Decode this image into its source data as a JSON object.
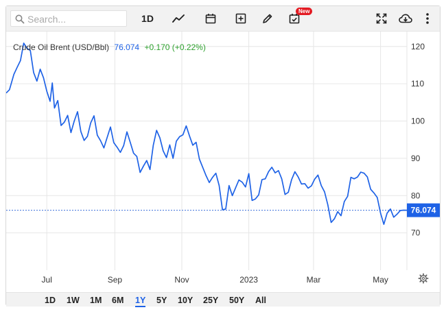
{
  "search": {
    "placeholder": "Search..."
  },
  "toolbar": {
    "range_label": "1D",
    "new_badge": "New",
    "icons": [
      "search-icon",
      "line-chart-icon",
      "calendar-icon",
      "add-indicator-icon",
      "pencil-icon",
      "event-calendar-icon",
      "fullscreen-icon",
      "download-cloud-icon",
      "more-icon"
    ]
  },
  "header": {
    "instrument": "Crude Oil Brent (USD/Bbl)",
    "last": "76.074",
    "change": "+0.170 (+0.22%)"
  },
  "colors": {
    "line": "#1e62e6",
    "change_positive": "#2ca02c",
    "price_label_bg": "#1e62e6"
  },
  "price_label": "76.074",
  "range_buttons": [
    "1D",
    "1W",
    "1M",
    "6M",
    "1Y",
    "5Y",
    "10Y",
    "25Y",
    "50Y",
    "All"
  ],
  "active_range": "1Y",
  "chart_data": {
    "type": "line",
    "title": "Crude Oil Brent (USD/Bbl)",
    "xlabel": "",
    "ylabel": "",
    "x_ticks": [
      "Jul",
      "Sep",
      "Nov",
      "2023",
      "Mar",
      "May"
    ],
    "y_ticks": [
      70,
      80,
      90,
      100,
      110,
      120
    ],
    "ylim": [
      60,
      124
    ],
    "xlim": [
      "2022-05-25",
      "2023-05-25"
    ],
    "grid": true,
    "last_value": 76.074,
    "series": [
      {
        "values": [
          [
            "2022-05-25",
            107.5
          ],
          [
            "2022-05-28",
            108.4
          ],
          [
            "2022-06-01",
            112.5
          ],
          [
            "2022-06-04",
            114.4
          ],
          [
            "2022-06-07",
            116.2
          ],
          [
            "2022-06-10",
            120.9
          ],
          [
            "2022-06-13",
            119.5
          ],
          [
            "2022-06-16",
            118.9
          ],
          [
            "2022-06-19",
            113.0
          ],
          [
            "2022-06-22",
            110.7
          ],
          [
            "2022-06-25",
            113.9
          ],
          [
            "2022-06-28",
            111.6
          ],
          [
            "2022-07-01",
            108.0
          ],
          [
            "2022-07-04",
            105.3
          ],
          [
            "2022-07-06",
            110.2
          ],
          [
            "2022-07-08",
            103.5
          ],
          [
            "2022-07-11",
            105.5
          ],
          [
            "2022-07-14",
            98.8
          ],
          [
            "2022-07-17",
            99.7
          ],
          [
            "2022-07-20",
            101.5
          ],
          [
            "2022-07-23",
            96.9
          ],
          [
            "2022-07-26",
            100.0
          ],
          [
            "2022-07-29",
            102.5
          ],
          [
            "2022-08-01",
            97.2
          ],
          [
            "2022-08-04",
            94.8
          ],
          [
            "2022-08-07",
            95.9
          ],
          [
            "2022-08-10",
            99.5
          ],
          [
            "2022-08-13",
            101.4
          ],
          [
            "2022-08-16",
            96.2
          ],
          [
            "2022-08-19",
            94.7
          ],
          [
            "2022-08-22",
            92.8
          ],
          [
            "2022-08-25",
            95.6
          ],
          [
            "2022-08-28",
            98.4
          ],
          [
            "2022-08-31",
            94.2
          ],
          [
            "2022-09-03",
            93.0
          ],
          [
            "2022-09-06",
            91.6
          ],
          [
            "2022-09-09",
            93.4
          ],
          [
            "2022-09-12",
            97.1
          ],
          [
            "2022-09-15",
            94.3
          ],
          [
            "2022-09-18",
            91.4
          ],
          [
            "2022-09-21",
            90.5
          ],
          [
            "2022-09-24",
            86.2
          ],
          [
            "2022-09-27",
            87.9
          ],
          [
            "2022-09-30",
            89.4
          ],
          [
            "2022-10-03",
            87.0
          ],
          [
            "2022-10-06",
            93.5
          ],
          [
            "2022-10-09",
            97.5
          ],
          [
            "2022-10-12",
            95.5
          ],
          [
            "2022-10-15",
            92.0
          ],
          [
            "2022-10-18",
            90.2
          ],
          [
            "2022-10-21",
            93.6
          ],
          [
            "2022-10-24",
            90.0
          ],
          [
            "2022-10-27",
            94.6
          ],
          [
            "2022-10-30",
            95.8
          ],
          [
            "2022-11-02",
            96.3
          ],
          [
            "2022-11-05",
            98.7
          ],
          [
            "2022-11-08",
            96.0
          ],
          [
            "2022-11-11",
            93.5
          ],
          [
            "2022-11-14",
            94.3
          ],
          [
            "2022-11-17",
            89.8
          ],
          [
            "2022-11-20",
            87.6
          ],
          [
            "2022-11-23",
            85.4
          ],
          [
            "2022-11-26",
            83.5
          ],
          [
            "2022-11-29",
            84.9
          ],
          [
            "2022-12-02",
            86.0
          ],
          [
            "2022-12-05",
            82.7
          ],
          [
            "2022-12-08",
            76.2
          ],
          [
            "2022-12-11",
            76.4
          ],
          [
            "2022-12-14",
            82.7
          ],
          [
            "2022-12-17",
            80.0
          ],
          [
            "2022-12-20",
            82.1
          ],
          [
            "2022-12-23",
            84.2
          ],
          [
            "2022-12-26",
            83.6
          ],
          [
            "2022-12-29",
            82.3
          ],
          [
            "2023-01-01",
            85.9
          ],
          [
            "2023-01-04",
            78.7
          ],
          [
            "2023-01-07",
            79.1
          ],
          [
            "2023-01-10",
            80.2
          ],
          [
            "2023-01-13",
            84.3
          ],
          [
            "2023-01-16",
            84.5
          ],
          [
            "2023-01-19",
            86.4
          ],
          [
            "2023-01-22",
            87.6
          ],
          [
            "2023-01-25",
            86.1
          ],
          [
            "2023-01-28",
            86.7
          ],
          [
            "2023-01-31",
            84.5
          ],
          [
            "2023-02-03",
            80.3
          ],
          [
            "2023-02-06",
            80.9
          ],
          [
            "2023-02-09",
            84.3
          ],
          [
            "2023-02-12",
            86.4
          ],
          [
            "2023-02-15",
            85.0
          ],
          [
            "2023-02-18",
            83.1
          ],
          [
            "2023-02-21",
            83.2
          ],
          [
            "2023-02-24",
            82.0
          ],
          [
            "2023-02-27",
            82.6
          ],
          [
            "2023-03-02",
            84.4
          ],
          [
            "2023-03-05",
            85.5
          ],
          [
            "2023-03-08",
            82.7
          ],
          [
            "2023-03-11",
            81.0
          ],
          [
            "2023-03-14",
            77.5
          ],
          [
            "2023-03-17",
            72.8
          ],
          [
            "2023-03-20",
            73.8
          ],
          [
            "2023-03-23",
            75.7
          ],
          [
            "2023-03-26",
            74.6
          ],
          [
            "2023-03-29",
            78.4
          ],
          [
            "2023-04-01",
            79.8
          ],
          [
            "2023-04-04",
            84.9
          ],
          [
            "2023-04-07",
            84.5
          ],
          [
            "2023-04-10",
            85.0
          ],
          [
            "2023-04-13",
            86.3
          ],
          [
            "2023-04-16",
            86.0
          ],
          [
            "2023-04-19",
            85.0
          ],
          [
            "2023-04-22",
            81.7
          ],
          [
            "2023-04-25",
            80.7
          ],
          [
            "2023-04-28",
            79.5
          ],
          [
            "2023-05-01",
            75.3
          ],
          [
            "2023-05-04",
            72.3
          ],
          [
            "2023-05-07",
            75.3
          ],
          [
            "2023-05-10",
            76.4
          ],
          [
            "2023-05-13",
            74.2
          ],
          [
            "2023-05-16",
            75.0
          ],
          [
            "2023-05-19",
            76.0
          ],
          [
            "2023-05-22",
            76.1
          ],
          [
            "2023-05-25",
            76.074
          ]
        ]
      }
    ]
  }
}
